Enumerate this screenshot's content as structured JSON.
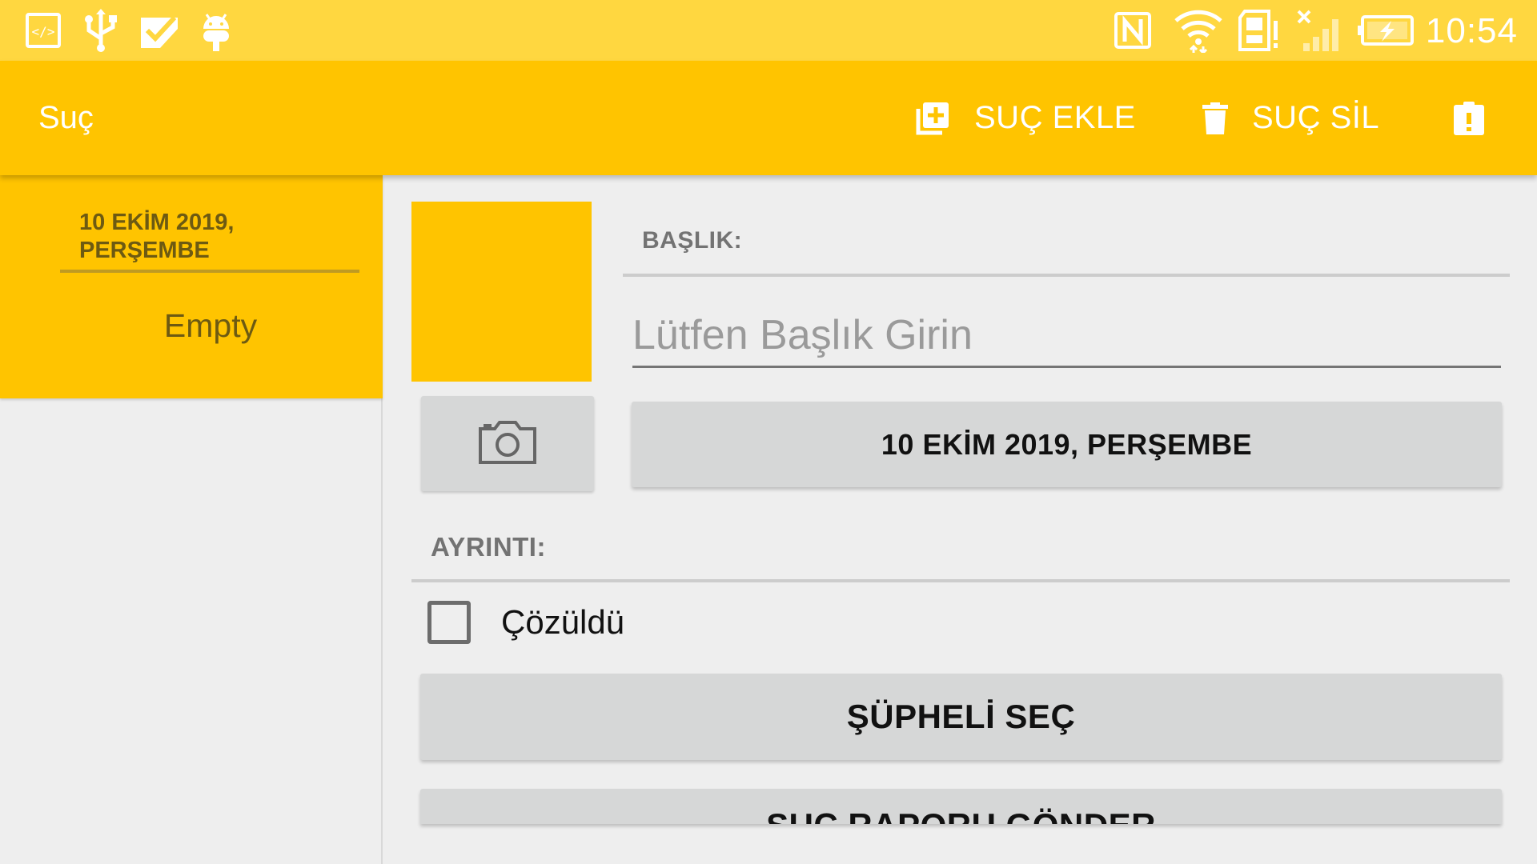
{
  "status_bar": {
    "time": "10:54",
    "left_icons": [
      "code-icon",
      "usb-icon",
      "checkmark-icon",
      "android-icon"
    ],
    "right_icons": [
      "nfc-icon",
      "wifi-icon",
      "sd-card-alert-icon",
      "cellular-no-signal-icon",
      "battery-charging-icon"
    ]
  },
  "app_bar": {
    "title": "Suç",
    "actions": {
      "add_label": "SUÇ EKLE",
      "delete_label": "SUÇ SİL",
      "report_icon": "report-clipboard-icon"
    },
    "background": "#ffc400"
  },
  "crime_list": {
    "items": [
      {
        "date": "10 EKİM 2019, PERŞEMBE",
        "title": "Empty"
      }
    ]
  },
  "detail": {
    "title_section_label": "BAŞLIK:",
    "title_input": {
      "value": "",
      "placeholder": "Lütfen Başlık Girin"
    },
    "camera_icon": "camera-icon",
    "date_button_label": "10 EKİM 2019, PERŞEMBE",
    "detail_section_label": "AYRINTI:",
    "solved": {
      "label": "Çözüldü",
      "checked": false
    },
    "suspect_button_label": "ŞÜPHELİ SEÇ",
    "report_button_label": "SUÇ RAPORU GÖNDER"
  },
  "colors": {
    "accent": "#ffc400",
    "status_bar": "#ffd740",
    "button": "#d6d7d7",
    "background": "#eeeeee"
  }
}
